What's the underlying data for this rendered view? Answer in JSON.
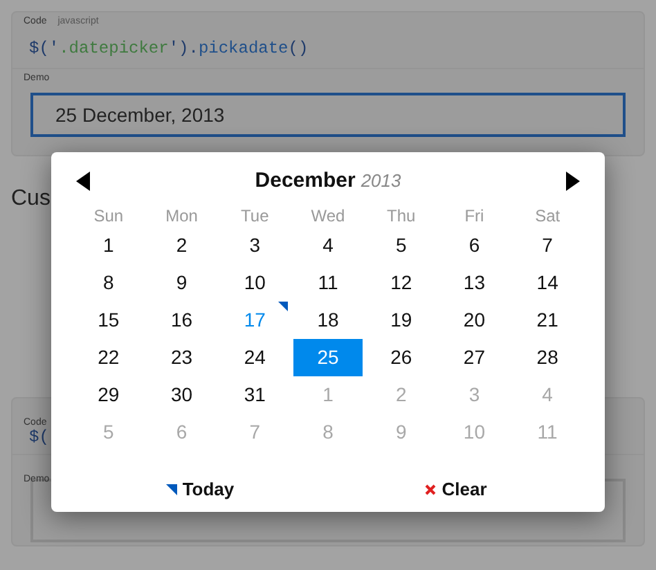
{
  "code_block": {
    "label": "Code",
    "language": "javascript",
    "code_parts": [
      {
        "kind": "punct",
        "text": "$('"
      },
      {
        "kind": "string",
        "text": ".datepicker"
      },
      {
        "kind": "punct",
        "text": "')."
      },
      {
        "kind": "method",
        "text": "pickadate"
      },
      {
        "kind": "punct",
        "text": "()"
      }
    ]
  },
  "demo": {
    "label": "Demo",
    "value": "25 December, 2013",
    "focused": true
  },
  "heading_fragment": "Cus",
  "code_block_2": {
    "label": "Code",
    "code_fragment": "$("
  },
  "demo_2": {
    "label": "Demo"
  },
  "datepicker": {
    "month": "December",
    "year": "2013",
    "weekdays": [
      "Sun",
      "Mon",
      "Tue",
      "Wed",
      "Thu",
      "Fri",
      "Sat"
    ],
    "weeks": [
      [
        {
          "text": "1",
          "outside": false,
          "selected": false,
          "today": false
        },
        {
          "text": "2",
          "outside": false,
          "selected": false,
          "today": false
        },
        {
          "text": "3",
          "outside": false,
          "selected": false,
          "today": false
        },
        {
          "text": "4",
          "outside": false,
          "selected": false,
          "today": false
        },
        {
          "text": "5",
          "outside": false,
          "selected": false,
          "today": false
        },
        {
          "text": "6",
          "outside": false,
          "selected": false,
          "today": false
        },
        {
          "text": "7",
          "outside": false,
          "selected": false,
          "today": false
        }
      ],
      [
        {
          "text": "8",
          "outside": false,
          "selected": false,
          "today": false
        },
        {
          "text": "9",
          "outside": false,
          "selected": false,
          "today": false
        },
        {
          "text": "10",
          "outside": false,
          "selected": false,
          "today": false
        },
        {
          "text": "11",
          "outside": false,
          "selected": false,
          "today": false
        },
        {
          "text": "12",
          "outside": false,
          "selected": false,
          "today": false
        },
        {
          "text": "13",
          "outside": false,
          "selected": false,
          "today": false
        },
        {
          "text": "14",
          "outside": false,
          "selected": false,
          "today": false
        }
      ],
      [
        {
          "text": "15",
          "outside": false,
          "selected": false,
          "today": false
        },
        {
          "text": "16",
          "outside": false,
          "selected": false,
          "today": false
        },
        {
          "text": "17",
          "outside": false,
          "selected": false,
          "today": true
        },
        {
          "text": "18",
          "outside": false,
          "selected": false,
          "today": false
        },
        {
          "text": "19",
          "outside": false,
          "selected": false,
          "today": false
        },
        {
          "text": "20",
          "outside": false,
          "selected": false,
          "today": false
        },
        {
          "text": "21",
          "outside": false,
          "selected": false,
          "today": false
        }
      ],
      [
        {
          "text": "22",
          "outside": false,
          "selected": false,
          "today": false
        },
        {
          "text": "23",
          "outside": false,
          "selected": false,
          "today": false
        },
        {
          "text": "24",
          "outside": false,
          "selected": false,
          "today": false
        },
        {
          "text": "25",
          "outside": false,
          "selected": true,
          "today": false
        },
        {
          "text": "26",
          "outside": false,
          "selected": false,
          "today": false
        },
        {
          "text": "27",
          "outside": false,
          "selected": false,
          "today": false
        },
        {
          "text": "28",
          "outside": false,
          "selected": false,
          "today": false
        }
      ],
      [
        {
          "text": "29",
          "outside": false,
          "selected": false,
          "today": false
        },
        {
          "text": "30",
          "outside": false,
          "selected": false,
          "today": false
        },
        {
          "text": "31",
          "outside": false,
          "selected": false,
          "today": false
        },
        {
          "text": "1",
          "outside": true,
          "selected": false,
          "today": false
        },
        {
          "text": "2",
          "outside": true,
          "selected": false,
          "today": false
        },
        {
          "text": "3",
          "outside": true,
          "selected": false,
          "today": false
        },
        {
          "text": "4",
          "outside": true,
          "selected": false,
          "today": false
        }
      ],
      [
        {
          "text": "5",
          "outside": true,
          "selected": false,
          "today": false
        },
        {
          "text": "6",
          "outside": true,
          "selected": false,
          "today": false
        },
        {
          "text": "7",
          "outside": true,
          "selected": false,
          "today": false
        },
        {
          "text": "8",
          "outside": true,
          "selected": false,
          "today": false
        },
        {
          "text": "9",
          "outside": true,
          "selected": false,
          "today": false
        },
        {
          "text": "10",
          "outside": true,
          "selected": false,
          "today": false
        },
        {
          "text": "11",
          "outside": true,
          "selected": false,
          "today": false
        }
      ]
    ],
    "buttons": [
      {
        "kind": "today",
        "label": "Today"
      },
      {
        "kind": "clear",
        "label": "Clear"
      }
    ]
  }
}
